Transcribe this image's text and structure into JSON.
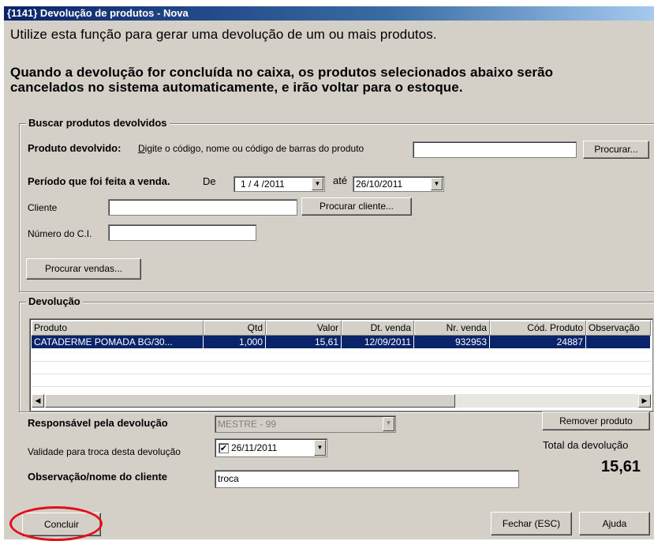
{
  "window": {
    "title": "{1141} Devolução de produtos - Nova"
  },
  "intro": {
    "line1": "Utilize esta função para gerar uma devolução de um ou mais produtos.",
    "line2": "Quando a devolução for concluída no caixa, os produtos selecionados abaixo serão",
    "line3": "cancelados no sistema automaticamente, e irão voltar para o estoque."
  },
  "search": {
    "group_title": "Buscar produtos devolvidos",
    "produto_label": "Produto devolvido:",
    "produto_hint": "Digite o código, nome ou código de barras do produto",
    "produto_value": "",
    "procurar_button": "Procurar...",
    "periodo_label": "Período que foi feita a venda.",
    "de_label": "De",
    "date_from": "1 / 4 /2011",
    "ate_label": "até",
    "date_to": "26/10/2011",
    "cliente_label": "Cliente",
    "cliente_value": "",
    "procurar_cliente_button": "Procurar cliente...",
    "ci_label": "Número do C.I.",
    "ci_value": "",
    "procurar_vendas_button": "Procurar vendas..."
  },
  "devolucao": {
    "group_title": "Devolução",
    "columns": [
      "Produto",
      "Qtd",
      "Valor",
      "Dt. venda",
      "Nr. venda",
      "Cód. Produto",
      "Observação"
    ],
    "rows": [
      [
        "CATADERME POMADA BG/30...",
        "1,000",
        "15,61",
        "12/09/2011",
        "932953",
        "24887",
        ""
      ]
    ]
  },
  "responsavel": {
    "label": "Responsável pela devolução",
    "value": "MESTRE - 99",
    "remover_button": "Remover produto"
  },
  "validade": {
    "label": "Validade para troca desta devolução",
    "checked": true,
    "date": "26/11/2011"
  },
  "observacao": {
    "label": "Observação/nome do cliente",
    "value": "troca"
  },
  "total": {
    "label": "Total da devolução",
    "value": "15,61"
  },
  "footer": {
    "concluir_button": "Concluir",
    "fechar_button": "Fechar (ESC)",
    "ajuda_button": "Ajuda"
  },
  "colors": {
    "highlight": "#0a246a",
    "annotation_ellipse": "#e0101a",
    "window_bg": "#d4d0c8"
  }
}
